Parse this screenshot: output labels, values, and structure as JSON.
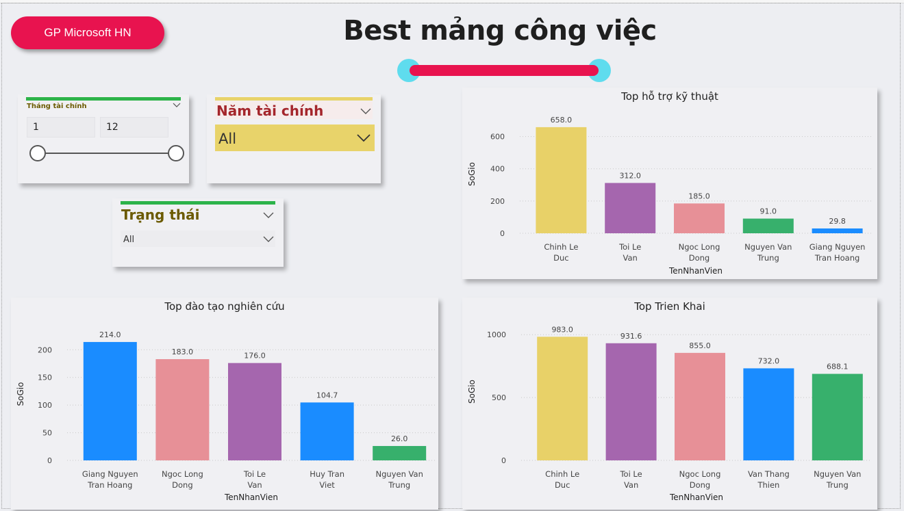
{
  "header": {
    "brand_button": "GP Microsoft HN",
    "title": "Best mảng công việc"
  },
  "colors": {
    "brand": "#e8134f",
    "cap": "#5fdcee",
    "accent_green": "#2db34a",
    "accent_yellow": "#e8d36a",
    "year_title": "#a4262c",
    "status_title": "#6b5a00"
  },
  "slicers": {
    "month": {
      "title": "Tháng tài chính",
      "from": "1",
      "to": "12",
      "range_fraction": [
        0,
        1
      ]
    },
    "year": {
      "title": "Năm tài chính",
      "value": "All"
    },
    "status": {
      "title": "Trạng thái",
      "value": "All"
    }
  },
  "chart_data": [
    {
      "id": "support",
      "type": "bar",
      "title": "Top hỗ trợ kỹ thuật",
      "xlabel": "TenNhanVien",
      "ylabel": "SoGio",
      "ylim": [
        0,
        700
      ],
      "yticks": [
        0,
        200,
        400,
        600
      ],
      "categories": [
        "Chinh Le Duc",
        "Toi Le Van",
        "Ngoc Long Dong",
        "Nguyen Van Trung",
        "Giang Nguyen Tran Hoang"
      ],
      "values": [
        658.0,
        312.0,
        185.0,
        91.0,
        29.8
      ],
      "value_labels": [
        "658.0",
        "312.0",
        "185.0",
        "91.0",
        "29.8"
      ],
      "colors": [
        "#e8d168",
        "#a566ae",
        "#e79097",
        "#37b06c",
        "#1a8cff"
      ]
    },
    {
      "id": "training",
      "type": "bar",
      "title": "Top đào tạo nghiên cứu",
      "xlabel": "TenNhanVien",
      "ylabel": "SoGio",
      "ylim": [
        0,
        230
      ],
      "yticks": [
        0,
        50,
        100,
        150,
        200
      ],
      "categories": [
        "Giang Nguyen Tran Hoang",
        "Ngoc Long Dong",
        "Toi Le Van",
        "Huy Tran Viet",
        "Nguyen Van Trung"
      ],
      "values": [
        214.0,
        183.0,
        176.0,
        104.7,
        26.0
      ],
      "value_labels": [
        "214.0",
        "183.0",
        "176.0",
        "104.7",
        "26.0"
      ],
      "colors": [
        "#1a8cff",
        "#e79097",
        "#a566ae",
        "#1a8cff",
        "#37b06c"
      ]
    },
    {
      "id": "deploy",
      "type": "bar",
      "title": "Top Trien Khai",
      "xlabel": "TenNhanVien",
      "ylabel": "SoGio",
      "ylim": [
        0,
        1050
      ],
      "yticks": [
        0,
        500,
        1000
      ],
      "categories": [
        "Chinh Le Duc",
        "Toi Le Van",
        "Ngoc Long Dong",
        "Van Thang Thien",
        "Nguyen Van Trung"
      ],
      "values": [
        983.0,
        931.6,
        855.0,
        732.0,
        688.1
      ],
      "value_labels": [
        "983.0",
        "931.6",
        "855.0",
        "732.0",
        "688.1"
      ],
      "colors": [
        "#e8d168",
        "#a566ae",
        "#e79097",
        "#1a8cff",
        "#37b06c"
      ]
    }
  ]
}
